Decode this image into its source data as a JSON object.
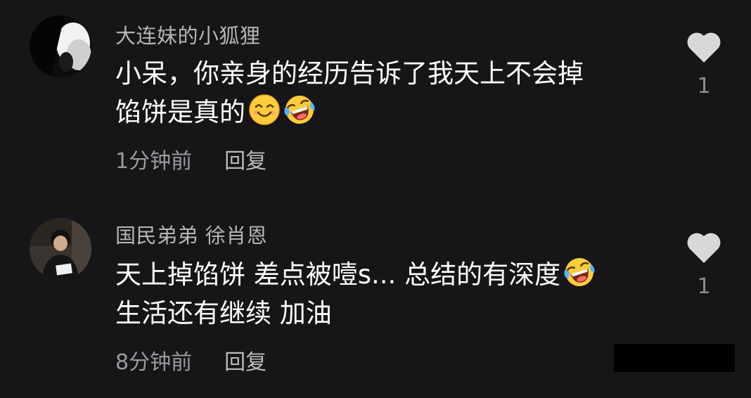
{
  "comments": [
    {
      "username": "大连妹的小狐狸",
      "lines": [
        "小呆，你亲身的经历告诉了我天上不会掉",
        "馅饼是真的"
      ],
      "emojis": [
        "smiling-face-emoji",
        "rolling-laughing-emoji"
      ],
      "time": "1分钟前",
      "reply_label": "回复",
      "like_count": "1"
    },
    {
      "username": "国民弟弟 徐肖恩",
      "lines": [
        "天上掉馅饼 差点被噎s... 总结的有深度",
        "生活还有继续 加油"
      ],
      "emojis": [
        "rolling-laughing-emoji"
      ],
      "time": "8分钟前",
      "reply_label": "回复",
      "like_count": "1"
    }
  ],
  "icons": {
    "like": "heart-icon"
  },
  "colors": {
    "background": "#161618",
    "username": "#b5b5b8",
    "text": "#ffffff",
    "meta": "#9a9a9e",
    "heart": "#d8d8da"
  }
}
